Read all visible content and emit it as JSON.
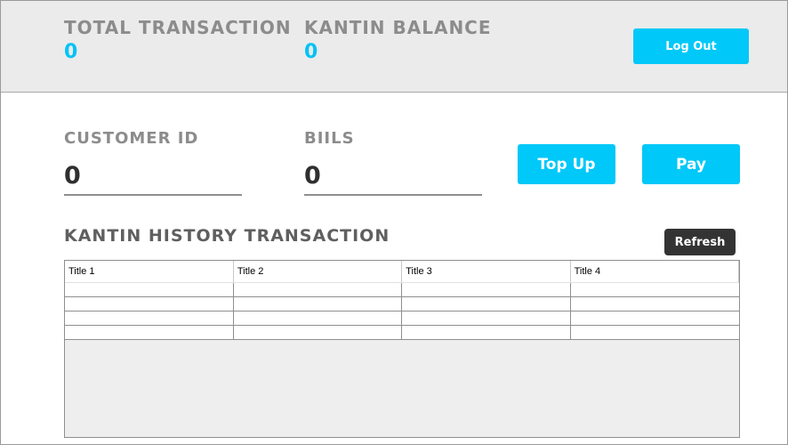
{
  "header": {
    "total_transaction_label": "TOTAL TRANSACTION",
    "total_transaction_value": "0",
    "kantin_balance_label": "KANTIN BALANCE",
    "kantin_balance_value": "0",
    "logout_label": "Log Out"
  },
  "form": {
    "customer_id_label": "CUSTOMER ID",
    "customer_id_value": "0",
    "bills_label": "BIILS",
    "bills_value": "0",
    "topup_label": "Top Up",
    "pay_label": "Pay"
  },
  "history": {
    "title": "KANTIN HISTORY TRANSACTION",
    "refresh_label": "Refresh",
    "columns": [
      "Title 1",
      "Title 2",
      "Title 3",
      "Title 4"
    ],
    "rows": [
      [
        "",
        "",
        "",
        ""
      ],
      [
        "",
        "",
        "",
        ""
      ],
      [
        "",
        "",
        "",
        ""
      ],
      [
        "",
        "",
        "",
        ""
      ]
    ]
  },
  "colors": {
    "accent": "#00c8f8",
    "header_bg": "#ebebeb",
    "dark_button": "#333333",
    "label_gray": "#8c8c8c"
  }
}
